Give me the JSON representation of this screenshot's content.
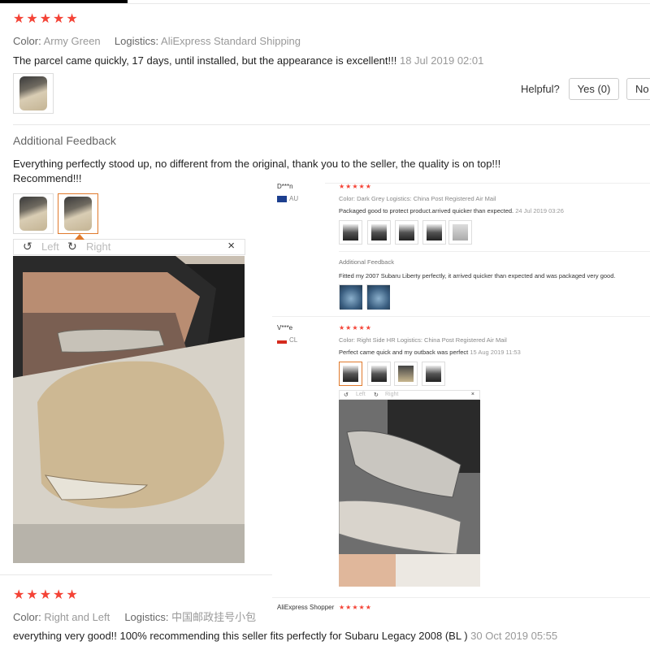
{
  "review1": {
    "stars": "★★★★★",
    "color_label": "Color:",
    "color_value": "Army Green",
    "logistics_label": "Logistics:",
    "logistics_value": "AliExpress Standard Shipping",
    "text": "The parcel came quickly, 17 days, until installed, but the appearance is excellent!!!",
    "date": "18 Jul 2019 02:01",
    "helpful_label": "Helpful?",
    "yes_label": "Yes (0)",
    "no_label": "No"
  },
  "additional": {
    "title": "Additional Feedback",
    "text": "Everything perfectly stood up, no different from the original, thank you to the seller, the quality is on top!!! Recommend!!!"
  },
  "viewer": {
    "left_label": "Left",
    "right_label": "Right",
    "close_glyph": "×",
    "rotate_left_glyph": "↺",
    "rotate_right_glyph": "↻"
  },
  "review3": {
    "stars": "★★★★★",
    "color_label": "Color:",
    "color_value": "Right and Left",
    "logistics_label": "Logistics:",
    "logistics_value": "中国邮政挂号小包",
    "text": "everything very good!! 100% recommending this seller fits perfectly for Subaru Legacy 2008 (BL )",
    "date": "30 Oct 2019 05:55"
  },
  "inset": {
    "rev_a": {
      "name": "D***n",
      "country": "AU",
      "stars": "★★★★★",
      "meta": "Color: Dark Grey   Logistics: China Post Registered Air Mail",
      "text": "Packaged good to protect product.arrived quicker than expected.",
      "date": "24 Jul 2019 03:26",
      "add_title": "Additional Feedback",
      "add_text": "Fitted my 2007 Subaru Liberty perfectly, it arrived quicker than expected and was packaged very good."
    },
    "rev_b": {
      "name": "V***e",
      "country": "CL",
      "stars": "★★★★★",
      "meta": "Color: Right Side HR   Logistics: China Post Registered Air Mail",
      "text": "Perfect came quick and my outback was perfect",
      "date": "15 Aug 2019 11:53",
      "viewer_left": "Left",
      "viewer_right": "Right",
      "viewer_close": "×"
    },
    "rev_c": {
      "name": "AliExpress Shopper",
      "stars": "★★★★★"
    }
  },
  "colors": {
    "star": "#f44336",
    "active_thumb_border": "#e07a2c"
  }
}
